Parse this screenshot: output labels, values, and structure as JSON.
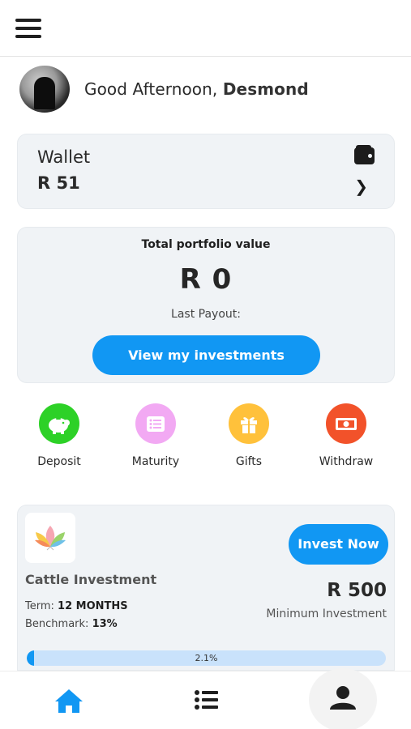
{
  "header": {
    "menu_icon": "hamburger-menu-icon"
  },
  "greeting": {
    "prefix": "Good Afternoon,",
    "name": "Desmond"
  },
  "wallet": {
    "title": "Wallet",
    "amount": "R 51",
    "icon": "wallet-icon",
    "action_icon": "chevron-right-icon"
  },
  "portfolio": {
    "label": "Total portfolio value",
    "value": "R 0",
    "payout_label": "Last Payout:",
    "button_label": "View my investments"
  },
  "actions": [
    {
      "label": "Deposit",
      "icon": "piggy-bank-icon",
      "color": "#2dd127"
    },
    {
      "label": "Maturity",
      "icon": "list-icon",
      "color": "#f2a9f3"
    },
    {
      "label": "Gifts",
      "icon": "gift-icon",
      "color": "#ffc13b"
    },
    {
      "label": "Withdraw",
      "icon": "cash-icon",
      "color": "#f2522a"
    }
  ],
  "investment": {
    "logo_icon": "lotus-logo-icon",
    "button_label": "Invest Now",
    "title": "Cattle Investment",
    "term_label": "Term:",
    "term_value": "12 MONTHS",
    "benchmark_label": "Benchmark:",
    "benchmark_value": "13%",
    "min_value": "R 500",
    "min_label": "Minimum Investment",
    "progress_text": "2.1%",
    "progress_fraction": 0.021
  },
  "bottom_nav": [
    {
      "icon": "home-icon",
      "active": true
    },
    {
      "icon": "list-icon",
      "active": false
    },
    {
      "icon": "profile-icon",
      "active": false
    }
  ],
  "colors": {
    "accent": "#1197f3",
    "card_bg": "#f0f3f6"
  }
}
